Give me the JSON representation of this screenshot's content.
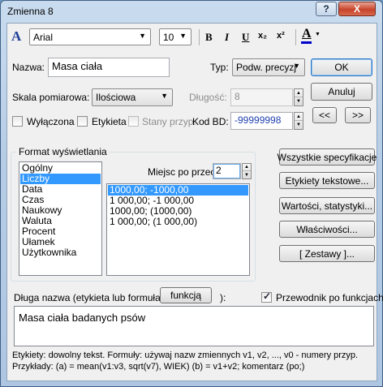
{
  "window": {
    "title": "Zmienna 8",
    "help_label": "?",
    "close_label": "X"
  },
  "toolbar": {
    "font_name": "Arial",
    "font_size": "10",
    "bold_label": "B",
    "italic_label": "I",
    "underline_label": "U",
    "subscript_label": "x₂",
    "superscript_label": "x²",
    "color_label": "A",
    "color_bar": "#0000cc"
  },
  "name": {
    "label": "Nazwa:",
    "value": "Masa ciała"
  },
  "type": {
    "label": "Typ:",
    "value": "Podw. precyzj"
  },
  "ok_label": "OK",
  "cancel_label": "Anuluj",
  "prev_label": "<<",
  "next_label": ">>",
  "scale": {
    "label": "Skala pomiarowa:",
    "value": "Ilościowa"
  },
  "length": {
    "label": "Długość:",
    "value": "8"
  },
  "checks": {
    "disabled_label": "Wyłączona",
    "label_label": "Etykieta",
    "states_label": "Stany przyp."
  },
  "code_bd": {
    "label": "Kod BD:",
    "value": "-99999998"
  },
  "format": {
    "group_label": "Format wyświetlania",
    "types": [
      "Ogólny",
      "Liczby",
      "Data",
      "Czas",
      "Naukowy",
      "Waluta",
      "Procent",
      "Ułamek",
      "Użytkownika"
    ],
    "selected_index": 1,
    "places_label": "Miejsc po przec:",
    "places_value": "2",
    "examples": [
      "1000,00; -1000,00",
      "1 000,00; -1 000,00",
      "1000,00; (1000,00)",
      "1 000,00; (1 000,00)"
    ]
  },
  "side_buttons": {
    "all_specs": "Wszystkie specyfikacje",
    "text_labels": "Etykiety tekstowe...",
    "values_stats": "Wartości, statystyki...",
    "properties": "Właściwości...",
    "sets": "[ Zestawy ]..."
  },
  "long_name": {
    "label_prefix": "Długa nazwa (etykieta lub formuła z",
    "function_button": "funkcją",
    "label_suffix": "):",
    "guide_label": "Przewodnik po funkcjach",
    "value": "Masa ciała badanych psów"
  },
  "help": {
    "line1": "Etykiety: dowolny tekst. Formuły: używaj nazw zmiennych v1, v2, ..., v0 - numery przyp.",
    "line2": "Przykłady:   (a) = mean(v1:v3, sqrt(v7), WIEK)  (b) = v1+v2; komentarz (po;)"
  }
}
